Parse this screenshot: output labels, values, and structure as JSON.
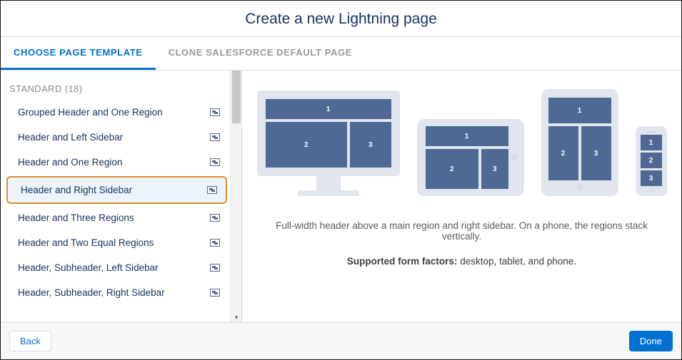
{
  "title": "Create a new Lightning page",
  "tabs": [
    {
      "label": "CHOOSE PAGE TEMPLATE",
      "active": true
    },
    {
      "label": "CLONE SALESFORCE DEFAULT PAGE",
      "active": false
    }
  ],
  "section_label": "STANDARD (18)",
  "templates": [
    {
      "label": "Grouped Header and One Region",
      "selected": false
    },
    {
      "label": "Header and Left Sidebar",
      "selected": false
    },
    {
      "label": "Header and One Region",
      "selected": false
    },
    {
      "label": "Header and Right Sidebar",
      "selected": true
    },
    {
      "label": "Header and Three Regions",
      "selected": false
    },
    {
      "label": "Header and Two Equal Regions",
      "selected": false
    },
    {
      "label": "Header, Subheader, Left Sidebar",
      "selected": false
    },
    {
      "label": "Header, Subheader, Right Sidebar",
      "selected": false
    }
  ],
  "preview": {
    "description": "Full-width header above a main region and right sidebar. On a phone, the regions stack vertically.",
    "form_factors_label": "Supported form factors:",
    "form_factors_value": "desktop, tablet, and phone.",
    "regions": {
      "r1": "1",
      "r2": "2",
      "r3": "3"
    }
  },
  "footer": {
    "back": "Back",
    "done": "Done"
  }
}
